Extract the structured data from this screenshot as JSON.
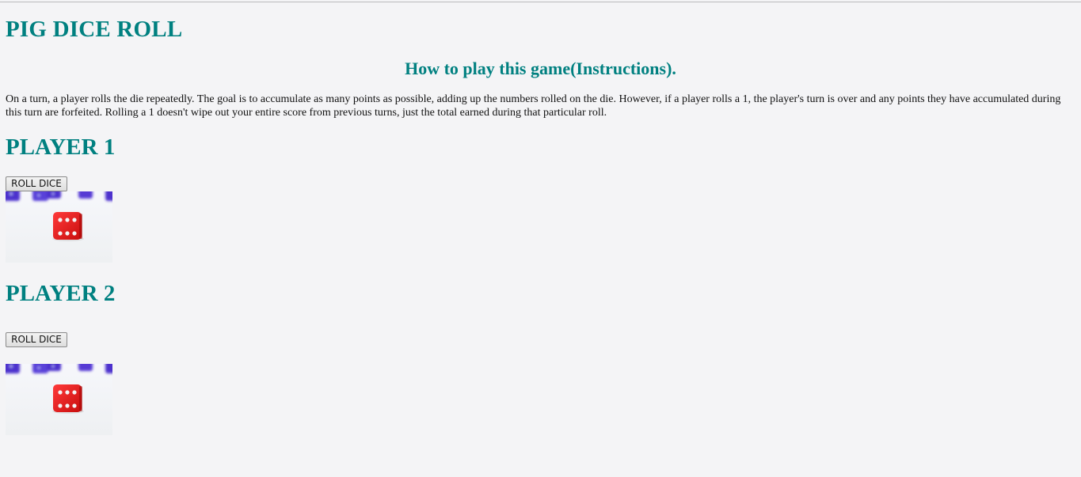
{
  "header": {
    "title": "PIG DICE ROLL"
  },
  "instructions": {
    "heading": "How to play this game(Instructions).",
    "text": "On a turn, a player rolls the die repeatedly. The goal is to accumulate as many points as possible, adding up the numbers rolled on the die. However, if a player rolls a 1, the player's turn is over and any points they have accumulated during this turn are forfeited. Rolling a 1 doesn't wipe out your entire score from previous turns, just the total earned during that particular roll."
  },
  "players": [
    {
      "label": "PLAYER 1",
      "button_label": "ROLL DICE",
      "die_face": 6,
      "die_icon": "dice-six-icon"
    },
    {
      "label": "PLAYER 2",
      "button_label": "ROLL DICE",
      "die_face": 6,
      "die_icon": "dice-six-icon"
    }
  ],
  "colors": {
    "heading": "#008080",
    "background": "#f4f4f6",
    "die_red": "#e31b1b",
    "blue_dice": "#3b1fc9"
  }
}
